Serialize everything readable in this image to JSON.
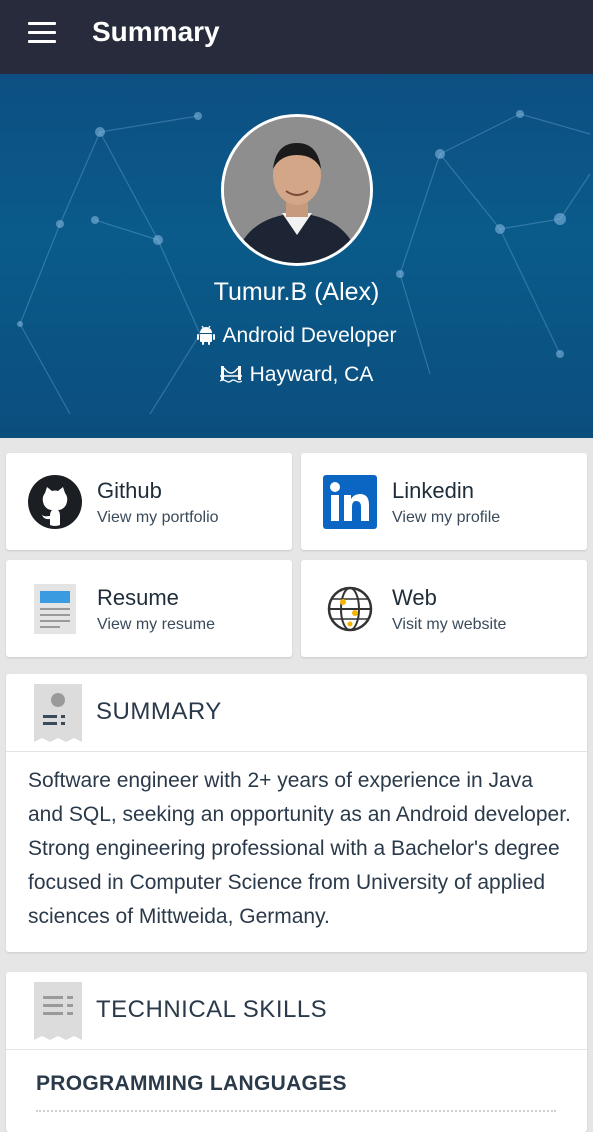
{
  "appbar": {
    "title": "Summary",
    "menu_icon": "hamburger-menu-icon"
  },
  "profile": {
    "name": "Tumur.B (Alex)",
    "role": "Android Developer",
    "location": "Hayward, CA",
    "role_icon": "android-icon",
    "location_icon": "bridge-icon"
  },
  "links": [
    {
      "title": "Github",
      "subtitle": "View my portfolio",
      "icon": "github-icon"
    },
    {
      "title": "Linkedin",
      "subtitle": "View my profile",
      "icon": "linkedin-icon"
    },
    {
      "title": "Resume",
      "subtitle": "View my resume",
      "icon": "document-icon"
    },
    {
      "title": "Web",
      "subtitle": "Visit my website",
      "icon": "globe-icon"
    }
  ],
  "summary": {
    "heading": "SUMMARY",
    "text": "Software engineer with 2+ years of experience in Java and SQL, seeking an opportunity as an Android developer. Strong engineering professional with a Bachelor's degree focused in Computer Science from University of applied sciences of Mittweida, Germany."
  },
  "skills": {
    "heading": "TECHNICAL SKILLS",
    "subheading": "PROGRAMMING LANGUAGES"
  },
  "colors": {
    "appbar": "#272b3b",
    "hero": "#0b4e7e",
    "linkedin": "#0a66c2",
    "text": "#2b3a4a"
  }
}
